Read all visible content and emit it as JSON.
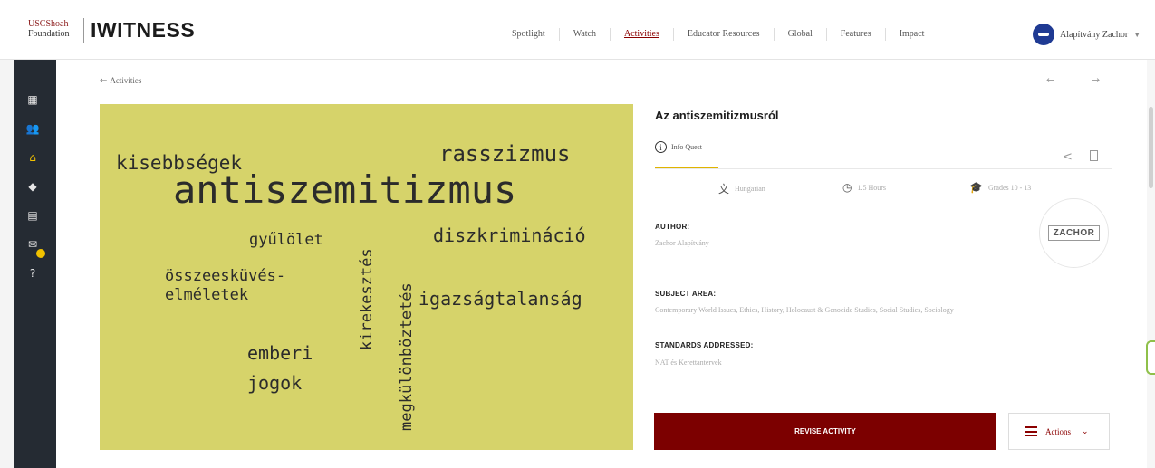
{
  "header": {
    "logo_org_line1": "USCShoah",
    "logo_org_line2": "Foundation",
    "app_title": "IWITNESS",
    "nav": [
      "Spotlight",
      "Watch",
      "Activities",
      "Educator Resources",
      "Global",
      "Features",
      "Impact"
    ],
    "active_nav": "Activities",
    "user_name": "Alapítvány Zachor"
  },
  "sidebar": {
    "icons": [
      "dashboard-icon",
      "people-icon",
      "activities-icon",
      "media-icon",
      "archive-icon",
      "messages-icon",
      "help-icon"
    ],
    "active_icon": "activities-icon"
  },
  "breadcrumb": {
    "back_label": "Activities"
  },
  "word_cloud": {
    "words": [
      "rasszizmus",
      "kisebbségek",
      "antiszemitizmus",
      "gyűlölet",
      "diszkrimináció",
      "összeesküvés-",
      "elméletek",
      "igazságtalanság",
      "emberi",
      "jogok",
      "kirekesztés",
      "megkülönböztetés"
    ]
  },
  "details": {
    "title": "Az antiszemitizmusról",
    "type": "Info Quest",
    "language": "Hungarian",
    "duration": "1.5 Hours",
    "grades": "Grades 10 - 13",
    "author_label": "AUTHOR:",
    "author_value": "Zachor Alapítvány",
    "author_logo_text": "ZACHOR",
    "subject_label": "SUBJECT AREA:",
    "subject_value": "Contemporary World Issues, Ethics, History, Holocaust & Genocide Studies, Social Studies, Sociology",
    "standards_label": "STANDARDS ADDRESSED:",
    "standards_value": "NAT és Kerettantervek",
    "revise_button": "REVISE ACTIVITY",
    "actions_button": "Actions"
  },
  "colors": {
    "brand_red": "#7c0000",
    "accent_yellow": "#e0b400",
    "cloud_bg": "#d6d36a",
    "sidebar_dark": "#252b33"
  }
}
